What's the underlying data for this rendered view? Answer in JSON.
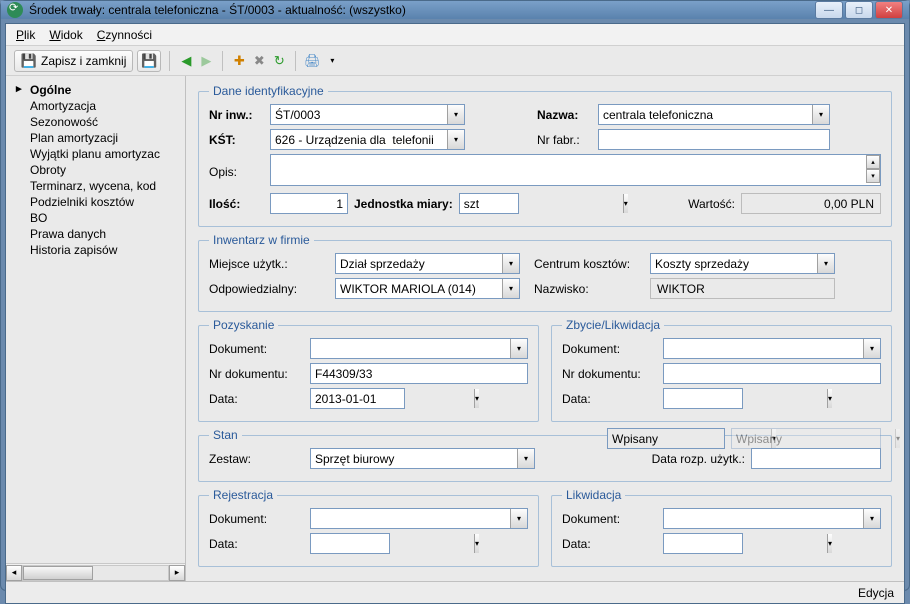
{
  "window": {
    "title": "Środek trwały: centrala telefoniczna - ŚT/0003 - aktualność: (wszystko)"
  },
  "menu": {
    "file": "Plik",
    "view": "Widok",
    "actions": "Czynności"
  },
  "toolbar": {
    "save_close": "Zapisz i zamknij"
  },
  "sidebar": {
    "items": [
      "Ogólne",
      "Amortyzacja",
      "Sezonowość",
      "Plan amortyzacji",
      "Wyjątki planu amortyzac",
      "Obroty",
      "Terminarz, wycena, kod",
      "Podzielniki kosztów",
      "BO",
      "Prawa danych",
      "Historia zapisów"
    ]
  },
  "ident": {
    "legend": "Dane identyfikacyjne",
    "nrinw_label": "Nr inw.:",
    "nrinw": "ŚT/0003",
    "nazwa_label": "Nazwa:",
    "nazwa": "centrala telefoniczna",
    "kst_label": "KŚT:",
    "kst": "626 - Urządzenia dla  telefonii",
    "nrfabr_label": "Nr fabr.:",
    "nrfabr": "",
    "opis_label": "Opis:",
    "opis": "",
    "ilosc_label": "Ilość:",
    "ilosc": "1",
    "jm_label": "Jednostka miary:",
    "jm": "szt",
    "wartosc_label": "Wartość:",
    "wartosc": "0,00 PLN"
  },
  "inw": {
    "legend": "Inwentarz w firmie",
    "miejsce_label": "Miejsce użytk.:",
    "miejsce": "Dział sprzedaży",
    "centrum_label": "Centrum kosztów:",
    "centrum": "Koszty sprzedaży",
    "odp_label": "Odpowiedzialny:",
    "odp": "WIKTOR MARIOLA (014)",
    "nazwisko_label": "Nazwisko:",
    "nazwisko": "WIKTOR"
  },
  "poz": {
    "legend": "Pozyskanie",
    "dok_label": "Dokument:",
    "dok": "",
    "nrdok_label": "Nr dokumentu:",
    "nrdok": "F44309/33",
    "data_label": "Data:",
    "data": "2013-01-01"
  },
  "zby": {
    "legend": "Zbycie/Likwidacja",
    "dok_label": "Dokument:",
    "dok": "",
    "nrdok_label": "Nr dokumentu:",
    "nrdok": "",
    "data_label": "Data:",
    "data": ""
  },
  "stan": {
    "legend": "Stan",
    "zestaw_label": "Zestaw:",
    "zestaw": "Sprzęt biurowy",
    "state1": "Wpisany",
    "state2": "Wpisany",
    "datarozp_label": "Data rozp. użytk.:",
    "datarozp": ""
  },
  "rej": {
    "legend": "Rejestracja",
    "dok_label": "Dokument:",
    "dok": "",
    "data_label": "Data:",
    "data": ""
  },
  "lik": {
    "legend": "Likwidacja",
    "dok_label": "Dokument:",
    "dok": "",
    "data_label": "Data:",
    "data": ""
  },
  "status": "Edycja"
}
